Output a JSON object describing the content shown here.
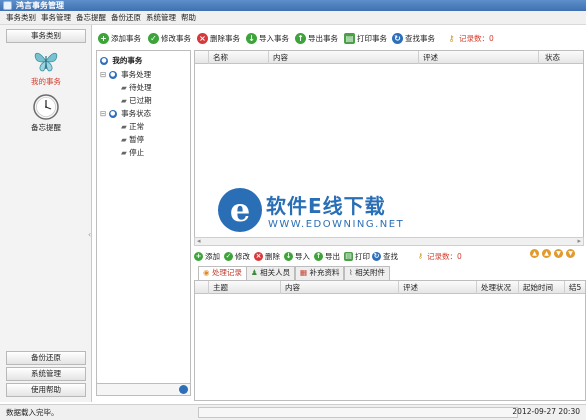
{
  "window": {
    "title": "鸿言事务管理"
  },
  "menu": [
    "事务类别",
    "事务管理",
    "备忘提醒",
    "备份还原",
    "系统管理",
    "帮助"
  ],
  "sidebar": {
    "header": "事务类别",
    "items": [
      {
        "label": "我的事务",
        "icon": "butterfly-icon",
        "active": true
      },
      {
        "label": "备忘提醒",
        "icon": "clock-icon",
        "active": false
      }
    ],
    "bottom_buttons": [
      "备份还原",
      "系统管理",
      "使用帮助"
    ]
  },
  "toolbar": {
    "buttons": [
      {
        "label": "添加事务",
        "icon": "add-icon"
      },
      {
        "label": "修改事务",
        "icon": "edit-icon"
      },
      {
        "label": "删除事务",
        "icon": "delete-icon"
      },
      {
        "label": "导入事务",
        "icon": "import-icon"
      },
      {
        "label": "导出事务",
        "icon": "export-icon"
      },
      {
        "label": "打印事务",
        "icon": "print-icon"
      },
      {
        "label": "查找事务",
        "icon": "search-icon"
      }
    ],
    "record_count": "记录数：0"
  },
  "tree": {
    "root": "我的事务",
    "groups": [
      {
        "label": "事务处理",
        "children": [
          "待处理",
          "已过期"
        ]
      },
      {
        "label": "事务状态",
        "children": [
          "正常",
          "暂停",
          "停止"
        ]
      }
    ]
  },
  "main_grid": {
    "columns": [
      "名称",
      "内容",
      "评述",
      "状态"
    ]
  },
  "watermark": {
    "main": "软件E线下载",
    "sub": "WWW.EDOWNING.NET",
    "logo_letter": "e"
  },
  "sub_toolbar": {
    "buttons": [
      {
        "label": "添加",
        "icon": "add-icon"
      },
      {
        "label": "修改",
        "icon": "edit-icon"
      },
      {
        "label": "删除",
        "icon": "delete-icon"
      },
      {
        "label": "导入",
        "icon": "import-icon"
      },
      {
        "label": "导出",
        "icon": "export-icon"
      },
      {
        "label": "打印",
        "icon": "print-icon"
      },
      {
        "label": "查找",
        "icon": "search-icon"
      }
    ],
    "record_count": "记录数：0"
  },
  "tabs": [
    "处理记录",
    "相关人员",
    "补充资料",
    "相关附件"
  ],
  "detail_grid": {
    "columns": [
      "主题",
      "内容",
      "评述",
      "处理状况",
      "起始时间",
      "结5"
    ]
  },
  "status": {
    "left": "数据载入完毕。",
    "right": "2012-09-27 20:30"
  },
  "colors": {
    "accent": "#3f70b0",
    "active_item": "#d23f2f",
    "watermark": "#2a6fb6"
  }
}
